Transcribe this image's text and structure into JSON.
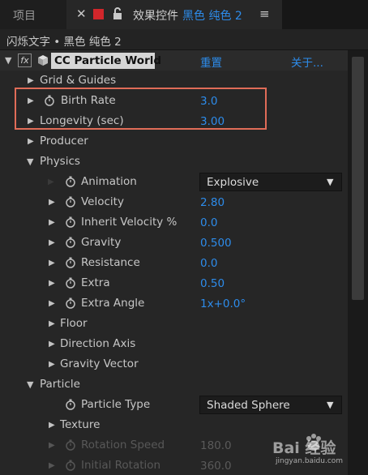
{
  "tabs": [
    {
      "label": "项目"
    },
    {
      "label": "效果控件",
      "layer": "黑色 纯色 2"
    }
  ],
  "tab_menu": "≡",
  "subheader": "闪烁文字 • 黑色 纯色 2",
  "effect": {
    "name": "CC Particle World",
    "reset": "重置",
    "about": "关于..."
  },
  "rows": {
    "grid_guides": {
      "label": "Grid & Guides"
    },
    "birth_rate": {
      "label": "Birth Rate",
      "value": "3.0"
    },
    "longevity": {
      "label": "Longevity (sec)",
      "value": "3.00"
    },
    "producer": {
      "label": "Producer"
    },
    "physics": {
      "label": "Physics"
    },
    "animation": {
      "label": "Animation",
      "value": "Explosive"
    },
    "velocity": {
      "label": "Velocity",
      "value": "2.80"
    },
    "inherit_velocity": {
      "label": "Inherit Velocity %",
      "value": "0.0"
    },
    "gravity": {
      "label": "Gravity",
      "value": "0.500"
    },
    "resistance": {
      "label": "Resistance",
      "value": "0.0"
    },
    "extra": {
      "label": "Extra",
      "value": "0.50"
    },
    "extra_angle": {
      "label": "Extra Angle",
      "value": "1x+0.0°"
    },
    "floor": {
      "label": "Floor"
    },
    "direction_axis": {
      "label": "Direction Axis"
    },
    "gravity_vector": {
      "label": "Gravity Vector"
    },
    "particle": {
      "label": "Particle"
    },
    "particle_type": {
      "label": "Particle Type",
      "value": "Shaded Sphere"
    },
    "texture": {
      "label": "Texture"
    },
    "rotation_speed": {
      "label": "Rotation Speed",
      "value": "180.0"
    },
    "initial_rotation": {
      "label": "Initial Rotation",
      "value": "360.0"
    }
  },
  "watermark": {
    "brand": "Bai 经验",
    "url": "jingyan.baidu.com"
  },
  "colors": {
    "accent": "#2d8ceb",
    "swatch": "#d1262b",
    "highlight": "#e06c58"
  }
}
